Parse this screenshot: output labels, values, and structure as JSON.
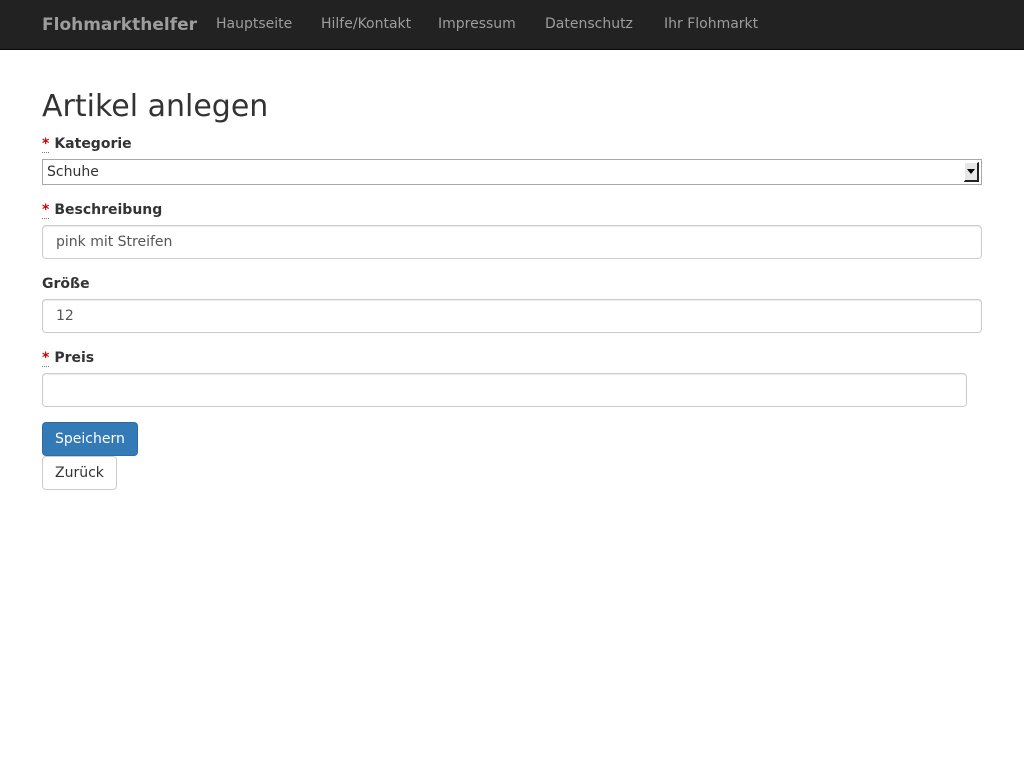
{
  "navbar": {
    "brand_light": "Flohmarkt",
    "brand_bold": "helfer",
    "links": [
      "Hauptseite",
      "Hilfe/Kontakt",
      "Impressum",
      "Datenschutz",
      "Ihr Flohmarkt"
    ]
  },
  "page": {
    "title": "Artikel anlegen"
  },
  "form": {
    "required_marker": "*",
    "kategorie": {
      "label": "Kategorie",
      "selected": "Schuhe"
    },
    "beschreibung": {
      "label": "Beschreibung",
      "value": "pink mit Streifen"
    },
    "groesse": {
      "label": "Größe",
      "value": "12"
    },
    "preis": {
      "label": "Preis",
      "value": ""
    },
    "save_label": "Speichern",
    "back_label": "Zurück"
  },
  "colors": {
    "navbar_bg": "#222222",
    "nav_text": "#9d9d9d",
    "primary": "#337ab7",
    "required": "#cc0000"
  }
}
